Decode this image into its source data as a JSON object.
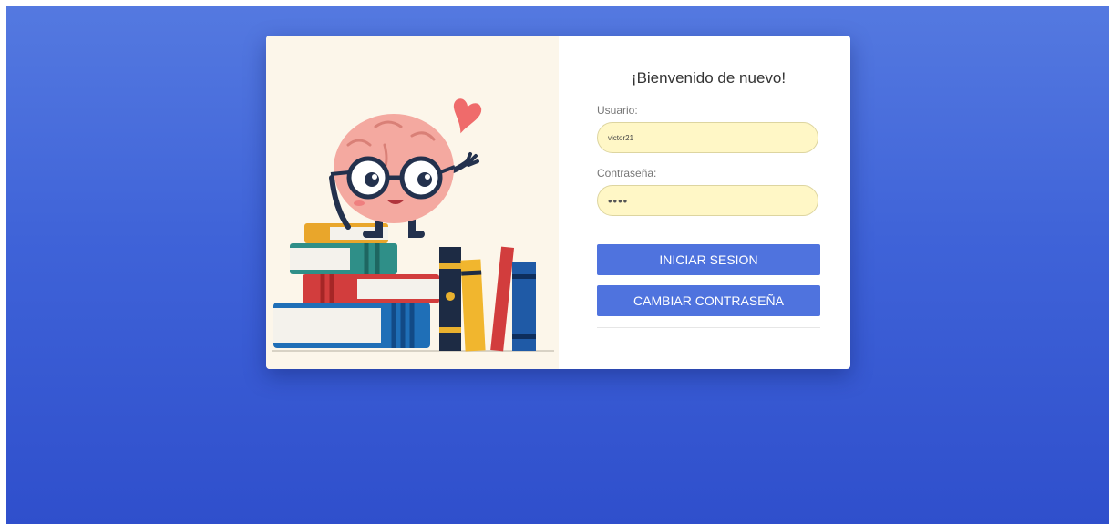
{
  "login": {
    "title": "¡Bienvenido de nuevo!",
    "username_label": "Usuario:",
    "username_value": "victor21",
    "password_label": "Contraseña:",
    "password_value": "••••",
    "login_button": "INICIAR SESION",
    "change_password_button": "CAMBIAR CONTRASEÑA"
  },
  "colors": {
    "background": "#3f63d8",
    "button": "#4f73de",
    "input_fill": "#fff7c6",
    "illustration_bg": "#fcf6ea"
  }
}
